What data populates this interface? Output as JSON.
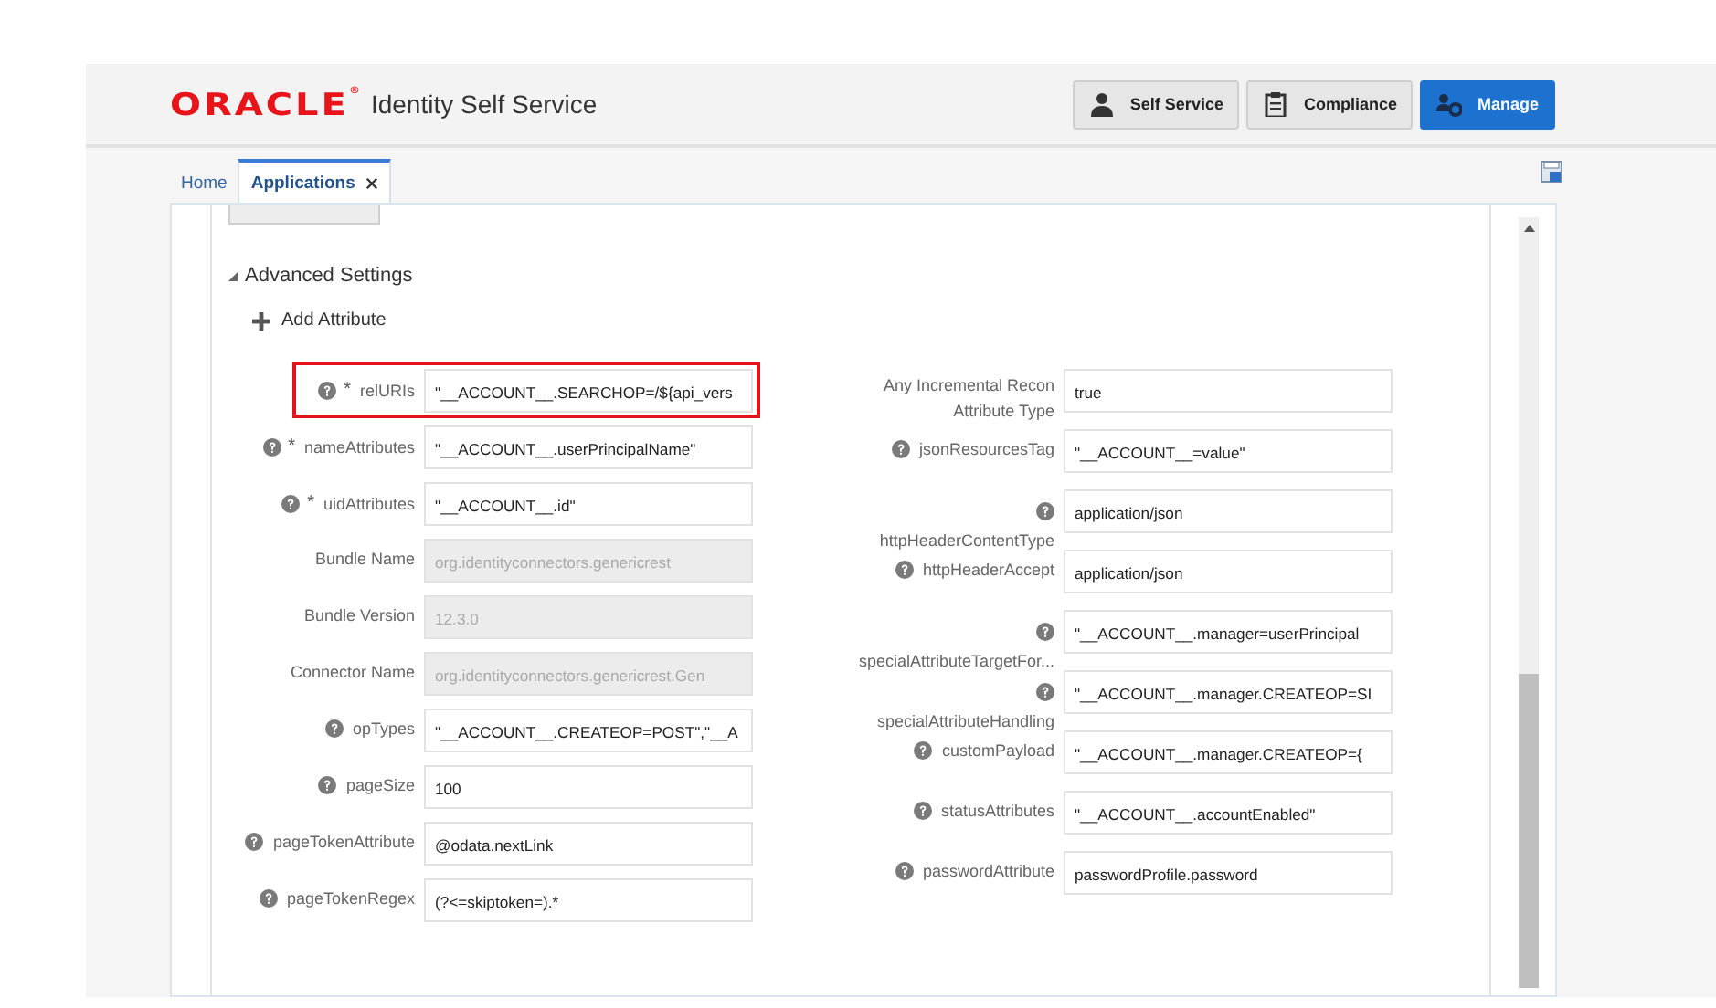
{
  "header": {
    "logo": "ORACLE$^{®}$",
    "title": "Identity Self Service",
    "nav_buttons": [
      {
        "label": "Self Service",
        "kind": "person",
        "selected": false
      },
      {
        "label": "Compliance",
        "kind": "clipboard",
        "selected": false
      },
      {
        "label": "Manage",
        "kind": "people-gear",
        "selected": true
      }
    ]
  },
  "tabs": [
    {
      "label": "Home",
      "selected": false,
      "closable": false
    },
    {
      "label": "Applications",
      "selected": true,
      "closable": true
    }
  ],
  "section": {
    "title": "Advanced Settings",
    "expanded": true,
    "add_button": "Add Attribute"
  },
  "required_mark": "*",
  "left_fields": [
    {
      "label": "relURIs",
      "value": "\"__ACCOUNT__.SEARCHOP=/${api_vers",
      "help": true,
      "required": true,
      "disabled": false,
      "highlighted": true,
      "kind": "inline"
    },
    {
      "label": "nameAttributes",
      "value": "\"__ACCOUNT__.userPrincipalName\"",
      "help": true,
      "required": true,
      "disabled": false,
      "highlighted": false,
      "kind": "inline"
    },
    {
      "label": "uidAttributes",
      "value": "\"__ACCOUNT__.id\"",
      "help": true,
      "required": true,
      "disabled": false,
      "highlighted": false,
      "kind": "inline"
    },
    {
      "label": "Bundle Name",
      "value": "org.identityconnectors.genericrest",
      "help": false,
      "required": false,
      "disabled": true,
      "highlighted": false,
      "kind": "inline"
    },
    {
      "label": "Bundle Version",
      "value": "12.3.0",
      "help": false,
      "required": false,
      "disabled": true,
      "highlighted": false,
      "kind": "inline"
    },
    {
      "label": "Connector Name",
      "value": "org.identityconnectors.genericrest.Gen",
      "help": false,
      "required": false,
      "disabled": true,
      "highlighted": false,
      "kind": "inline"
    },
    {
      "label": "opTypes",
      "value": "\"__ACCOUNT__.CREATEOP=POST\",\"__A",
      "help": true,
      "required": false,
      "disabled": false,
      "highlighted": false,
      "kind": "inline"
    },
    {
      "label": "pageSize",
      "value": "100",
      "help": true,
      "required": false,
      "disabled": false,
      "highlighted": false,
      "kind": "inline"
    },
    {
      "label": "pageTokenAttribute",
      "value": "@odata.nextLink",
      "help": true,
      "required": false,
      "disabled": false,
      "highlighted": false,
      "kind": "inline"
    },
    {
      "label": "pageTokenRegex",
      "value": "(?<=skiptoken=).*",
      "help": true,
      "required": false,
      "disabled": false,
      "highlighted": false,
      "kind": "inline"
    }
  ],
  "right_fields": [
    {
      "label": "Any Incremental Recon Attribute Type",
      "value": "true",
      "help": false,
      "required": false,
      "disabled": false,
      "highlighted": false,
      "kind": "wrap"
    },
    {
      "label": "jsonResourcesTag",
      "value": "\"__ACCOUNT__=value\"",
      "help": true,
      "required": false,
      "disabled": false,
      "highlighted": false,
      "kind": "inline"
    },
    {
      "label": "httpHeaderContentType",
      "value": "application/json",
      "help": true,
      "required": false,
      "disabled": false,
      "highlighted": false,
      "kind": "stacked"
    },
    {
      "label": "httpHeaderAccept",
      "value": "application/json",
      "help": true,
      "required": false,
      "disabled": false,
      "highlighted": false,
      "kind": "inline"
    },
    {
      "label": "specialAttributeTargetFor...",
      "value": "\"__ACCOUNT__.manager=userPrincipal",
      "help": true,
      "required": false,
      "disabled": false,
      "highlighted": false,
      "kind": "stacked"
    },
    {
      "label": "specialAttributeHandling",
      "value": "\"__ACCOUNT__.manager.CREATEOP=SI",
      "help": true,
      "required": false,
      "disabled": false,
      "highlighted": false,
      "kind": "stacked"
    },
    {
      "label": "customPayload",
      "value": "\"__ACCOUNT__.manager.CREATEOP={",
      "help": true,
      "required": false,
      "disabled": false,
      "highlighted": false,
      "kind": "inline"
    },
    {
      "label": "statusAttributes",
      "value": "\"__ACCOUNT__.accountEnabled\"",
      "help": true,
      "required": false,
      "disabled": false,
      "highlighted": false,
      "kind": "inline"
    },
    {
      "label": "passwordAttribute",
      "value": "passwordProfile.password",
      "help": true,
      "required": false,
      "disabled": false,
      "highlighted": false,
      "kind": "inline"
    }
  ]
}
